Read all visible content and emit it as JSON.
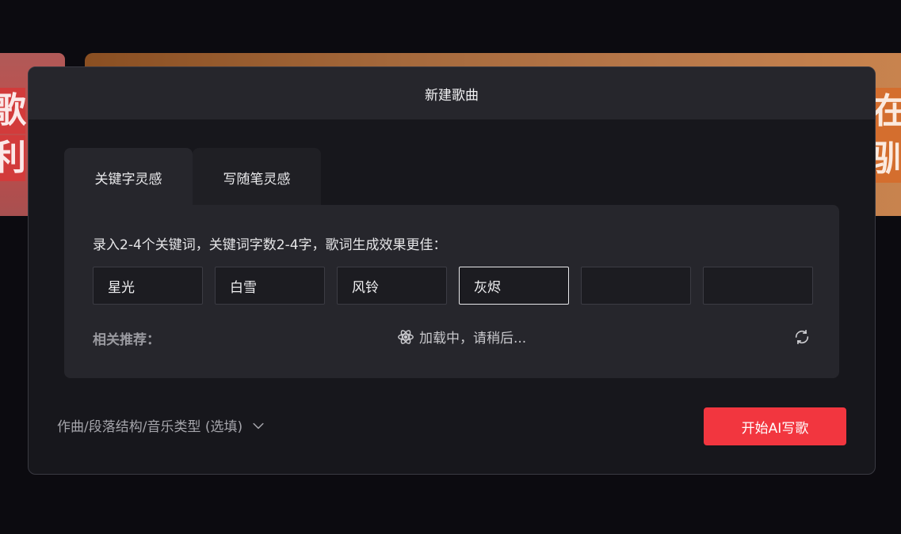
{
  "background": {
    "left_card_chars": [
      "歌",
      "利"
    ],
    "right_card_chars": [
      "在",
      "驯"
    ]
  },
  "modal": {
    "title": "新建歌曲",
    "tabs": [
      {
        "label": "关键字灵感",
        "active": true
      },
      {
        "label": "写随笔灵感",
        "active": false
      }
    ],
    "hint": "录入2-4个关键词，关键词字数2-4字，歌词生成效果更佳：",
    "keywords": [
      {
        "value": "星光",
        "placeholder": ""
      },
      {
        "value": "白雪",
        "placeholder": ""
      },
      {
        "value": "风铃",
        "placeholder": ""
      },
      {
        "value": "灰烬",
        "placeholder": ""
      },
      {
        "value": "",
        "placeholder": ""
      },
      {
        "value": "",
        "placeholder": ""
      }
    ],
    "related_label": "相关推荐：",
    "loading_text": "加载中，请稍后...",
    "options_label": "作曲/段落结构/音乐类型 (选填)",
    "start_button": "开始AI写歌"
  },
  "colors": {
    "accent": "#f2363f",
    "modal_bg": "#17171c",
    "panel_bg": "#26262c"
  }
}
